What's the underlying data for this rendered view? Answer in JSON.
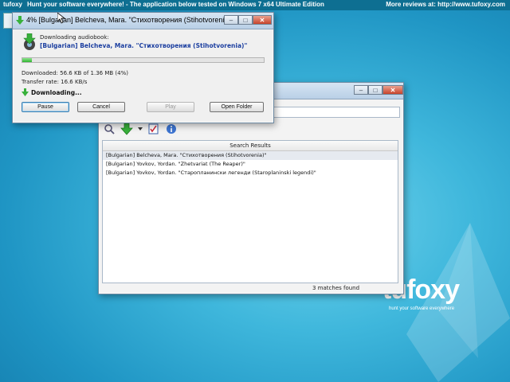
{
  "banner": {
    "logo": "tufoxy",
    "ad_text": "Hunt your software everywhere!  -  The application below tested on Windows 7 x64 Ultimate Edition",
    "reviews_text": "More reviews at: http://www.tufoxy.com"
  },
  "watermark": {
    "name": "tufoxy",
    "tagline": "hunt your software everywhere"
  },
  "download_dialog": {
    "title": "4% [Bulgarian] Belcheva, Mara. \"Стихотворения (Stihotvorenia)\"",
    "downloading_label": "Downloading audiobook:",
    "item_title": "[Bulgarian] Belcheva, Mara. \"Стихотворения (Stihotvorenia)\"",
    "progress": 0.04,
    "downloaded_text": "Downloaded: 56.6 KB of 1.36 MB (4%)",
    "transfer_rate_text": "Transfer rate: 16.6 KB/s",
    "status_text": "Downloading...",
    "buttons": {
      "pause": "Pause",
      "cancel": "Cancel",
      "play": "Play",
      "open_folder": "Open Folder"
    }
  },
  "main_window": {
    "results_header": "Search Results",
    "results": [
      "[Bulgarian] Belcheva, Mara. \"Стихотворения (Stihotvorenia)\"",
      "[Bulgarian] Yovkov, Yordan. \"Zhetvariat (The Reaper)\"",
      "[Bulgarian] Yovkov, Yordan. \"Старопланински легенди (Staroplaninski legendi)\""
    ],
    "status": "3 matches found"
  },
  "colors": {
    "accent_blue": "#1c3fa0",
    "progress_green": "#2fb42f",
    "banner_bg": "#0e6f92"
  }
}
